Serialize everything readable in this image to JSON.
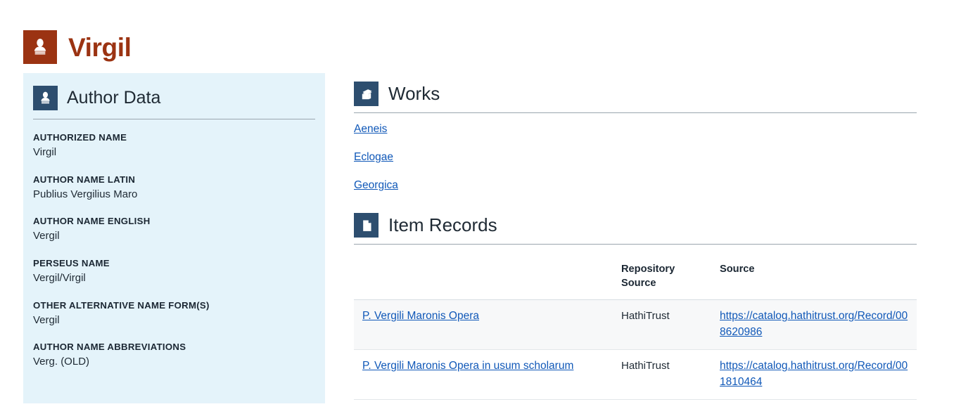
{
  "brand": {
    "title": "Virgil",
    "icon": "bust-statue-icon",
    "color": "#9b3312"
  },
  "sidebar": {
    "icon": "bust-statue-icon",
    "title": "Author Data",
    "background": "#e4f3fa",
    "fields": [
      {
        "label": "AUTHORIZED NAME",
        "value": "Virgil"
      },
      {
        "label": "AUTHOR NAME LATIN",
        "value": "Publius Vergilius Maro"
      },
      {
        "label": "AUTHOR NAME ENGLISH",
        "value": "Vergil"
      },
      {
        "label": "PERSEUS NAME",
        "value": "Vergil/Virgil"
      },
      {
        "label": "OTHER ALTERNATIVE NAME FORM(S)",
        "value": "Vergil"
      },
      {
        "label": "AUTHOR NAME ABBREVIATIONS",
        "value": "Verg. (OLD)"
      }
    ]
  },
  "works": {
    "icon": "books-icon",
    "title": "Works",
    "items": [
      {
        "label": "Aeneis"
      },
      {
        "label": "Eclogae"
      },
      {
        "label": "Georgica"
      }
    ]
  },
  "item_records": {
    "icon": "document-icon",
    "title": "Item Records",
    "columns": [
      "",
      "Repository Source",
      "Source"
    ],
    "rows": [
      {
        "title": "P. Vergili Maronis Opera",
        "repository_source": "HathiTrust",
        "source_url": "https://catalog.hathitrust.org/Record/008620986"
      },
      {
        "title": "P. Vergili Maronis Opera in usum scholarum",
        "repository_source": "HathiTrust",
        "source_url": "https://catalog.hathitrust.org/Record/001810464"
      }
    ]
  },
  "theme": {
    "link_color": "#1058b8",
    "panel_icon_color": "#2d4e6f",
    "brand_color": "#9b3312",
    "sidebar_bg": "#e4f3fa",
    "row_stripe": "#f7f8f9"
  }
}
